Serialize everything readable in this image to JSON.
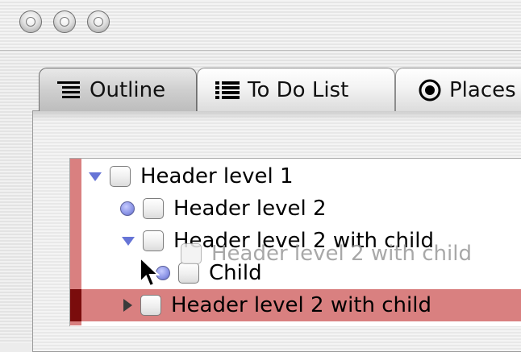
{
  "window": {
    "controls": [
      "close",
      "minimize",
      "zoom"
    ]
  },
  "tabs": [
    {
      "label": "Outline",
      "icon": "outline-icon",
      "selected": true
    },
    {
      "label": "To Do List",
      "icon": "list-icon",
      "selected": false
    },
    {
      "label": "Places",
      "icon": "radio-icon",
      "selected": false
    }
  ],
  "outline": {
    "rows": [
      {
        "label": "Header level 1",
        "marker": "expanded-triangle"
      },
      {
        "label": "Header level 2",
        "marker": "bullet"
      },
      {
        "label": "Header level 2 with child",
        "marker": "expanded-triangle"
      },
      {
        "label": "Child",
        "marker": "bullet"
      },
      {
        "label": "Header level 2 with child",
        "marker": "collapsed-triangle",
        "selected": true
      }
    ],
    "drag_ghost": {
      "label": "Header level 2 with child"
    }
  },
  "colors": {
    "selection": "#d98080",
    "selection_bar_dark": "#7a0c0c",
    "disclosure_triangle": "#6674d6"
  }
}
